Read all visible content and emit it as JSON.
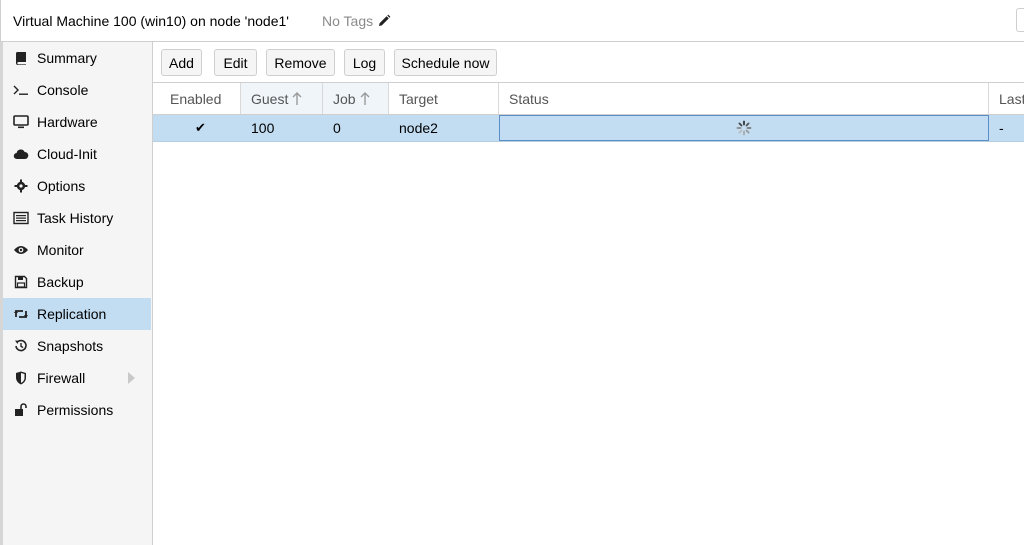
{
  "header": {
    "title": "Virtual Machine 100 (win10) on node 'node1'",
    "tags": "No Tags"
  },
  "sidebar": {
    "items": [
      {
        "label": "Summary",
        "icon": "book-icon"
      },
      {
        "label": "Console",
        "icon": "terminal-icon"
      },
      {
        "label": "Hardware",
        "icon": "desktop-icon"
      },
      {
        "label": "Cloud-Init",
        "icon": "cloud-icon"
      },
      {
        "label": "Options",
        "icon": "gear-icon"
      },
      {
        "label": "Task History",
        "icon": "list-icon"
      },
      {
        "label": "Monitor",
        "icon": "eye-icon"
      },
      {
        "label": "Backup",
        "icon": "floppy-icon"
      },
      {
        "label": "Replication",
        "icon": "retweet-icon",
        "active": true
      },
      {
        "label": "Snapshots",
        "icon": "history-icon"
      },
      {
        "label": "Firewall",
        "icon": "shield-icon",
        "has_submenu": true
      },
      {
        "label": "Permissions",
        "icon": "unlock-icon"
      }
    ]
  },
  "toolbar": {
    "add": "Add",
    "edit": "Edit",
    "remove": "Remove",
    "log": "Log",
    "schedule_now": "Schedule now"
  },
  "grid": {
    "columns": [
      "Enabled",
      "Guest",
      "Job",
      "Target",
      "Status",
      "Last"
    ],
    "sorted_columns": [
      "Guest",
      "Job"
    ],
    "rows": [
      {
        "enabled": "✔",
        "guest": "100",
        "job": "0",
        "target": "node2",
        "status": "loading-spinner-icon",
        "last": "-"
      }
    ]
  },
  "colors": {
    "selection": "#c2ddf2",
    "sidebar_bg": "#f5f5f5",
    "border": "#cfcfcf"
  }
}
